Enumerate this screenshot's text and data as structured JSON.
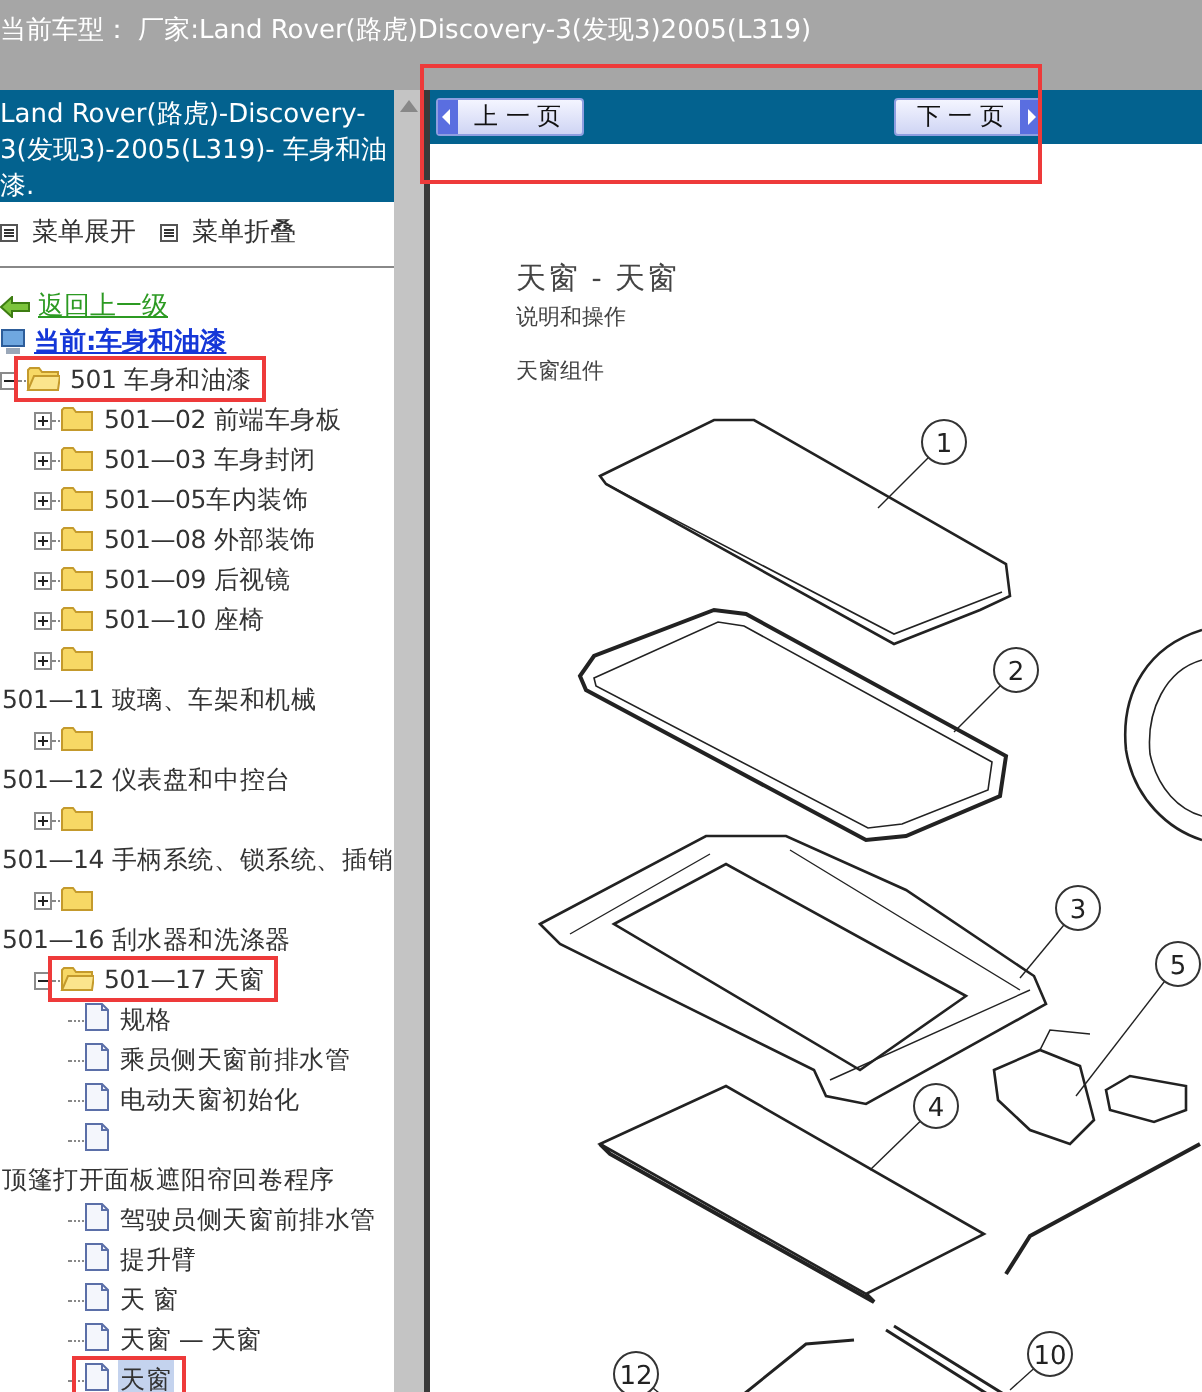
{
  "header": {
    "title": "当前车型： 厂家:Land Rover(路虎)Discovery-3(发现3)2005(L319)"
  },
  "sidebar": {
    "heading": "Land Rover(路虎)-Discovery-3(发现3)-2005(L319)- 车身和油漆.",
    "menu_buttons": [
      "菜单展开",
      "菜单折叠"
    ],
    "back_link": "返回上一级",
    "current_link": "当前:车身和油漆",
    "tree": [
      {
        "label": "501 车身和油漆",
        "kind": "folder",
        "expanded": true,
        "selected": false,
        "highlighted": true,
        "children": [
          {
            "label": "501—02 前端车身板",
            "kind": "folder",
            "expanded": false,
            "selected": false,
            "highlighted": false
          },
          {
            "label": "501—03 车身封闭",
            "kind": "folder",
            "expanded": false,
            "selected": false,
            "highlighted": false
          },
          {
            "label": "501—05车内装饰",
            "kind": "folder",
            "expanded": false,
            "selected": false,
            "highlighted": false
          },
          {
            "label": "501—08 外部装饰",
            "kind": "folder",
            "expanded": false,
            "selected": false,
            "highlighted": false
          },
          {
            "label": "501—09 后视镜",
            "kind": "folder",
            "expanded": false,
            "selected": false,
            "highlighted": false
          },
          {
            "label": "501—10 座椅",
            "kind": "folder",
            "expanded": false,
            "selected": false,
            "highlighted": false
          },
          {
            "label": "501—11 玻璃、车架和机械",
            "kind": "folder",
            "expanded": false,
            "selected": false,
            "highlighted": false
          },
          {
            "label": "501—12 仪表盘和中控台",
            "kind": "folder",
            "expanded": false,
            "selected": false,
            "highlighted": false
          },
          {
            "label": "501—14 手柄系统、锁系统、插销",
            "kind": "folder",
            "expanded": false,
            "selected": false,
            "highlighted": false
          },
          {
            "label": "501—16 刮水器和洗涤器",
            "kind": "folder",
            "expanded": false,
            "selected": false,
            "highlighted": false
          },
          {
            "label": "501—17 天窗",
            "kind": "folder",
            "expanded": true,
            "selected": false,
            "highlighted": true,
            "children": [
              {
                "label": "规格",
                "kind": "page",
                "selected": false,
                "highlighted": false
              },
              {
                "label": "乘员侧天窗前排水管",
                "kind": "page",
                "selected": false,
                "highlighted": false
              },
              {
                "label": "电动天窗初始化",
                "kind": "page",
                "selected": false,
                "highlighted": false
              },
              {
                "label": "顶篷打开面板遮阳帘回卷程序",
                "kind": "page",
                "selected": false,
                "highlighted": false
              },
              {
                "label": "驾驶员侧天窗前排水管",
                "kind": "page",
                "selected": false,
                "highlighted": false
              },
              {
                "label": "提升臂",
                "kind": "page",
                "selected": false,
                "highlighted": false
              },
              {
                "label": "天 窗",
                "kind": "page",
                "selected": false,
                "highlighted": false
              },
              {
                "label": "天窗 — 天窗",
                "kind": "page",
                "selected": false,
                "highlighted": false
              },
              {
                "label": "天窗",
                "kind": "page",
                "selected": true,
                "highlighted": true
              }
            ]
          }
        ]
      }
    ]
  },
  "document": {
    "nav": {
      "highlighted": true,
      "prev_button": "上 一 页",
      "next_button": "下 一 页"
    },
    "title": "天窗 - 天窗",
    "subtitle": "说明和操作",
    "section": "天窗组件",
    "callouts": [
      "1",
      "2",
      "3",
      "4",
      "5",
      "10",
      "12"
    ]
  }
}
